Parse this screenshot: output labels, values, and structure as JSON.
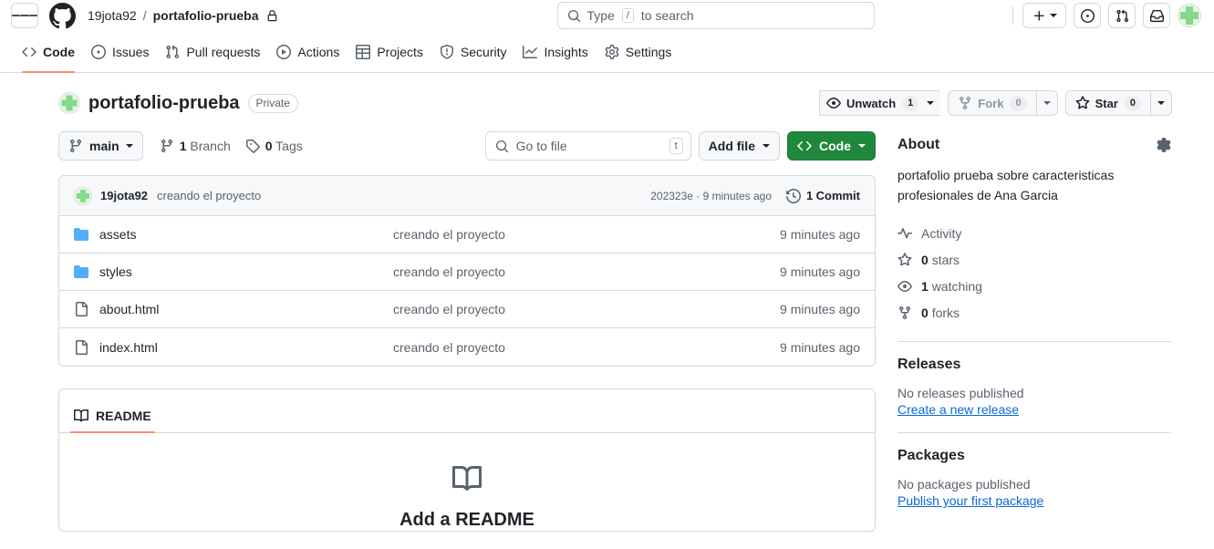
{
  "header": {
    "menu_label": "menu",
    "owner": "19jota92",
    "separator": "/",
    "repo": "portafolio-prueba",
    "search_placeholder": "Type",
    "search_key": "/",
    "search_placeholder_tail": "to search",
    "create_new_label": "create-new",
    "issues_label": "issues",
    "pull_requests_label": "pull-requests",
    "inbox_label": "inbox",
    "avatar_label": "19jota92"
  },
  "nav": {
    "items": [
      {
        "label": "Code",
        "icon": "code-icon",
        "active": true
      },
      {
        "label": "Issues",
        "icon": "issue-opened-icon",
        "active": false
      },
      {
        "label": "Pull requests",
        "icon": "git-pull-request-icon",
        "active": false
      },
      {
        "label": "Actions",
        "icon": "play-icon",
        "active": false
      },
      {
        "label": "Projects",
        "icon": "table-icon",
        "active": false
      },
      {
        "label": "Security",
        "icon": "shield-icon",
        "active": false
      },
      {
        "label": "Insights",
        "icon": "graph-icon",
        "active": false
      },
      {
        "label": "Settings",
        "icon": "gear-icon",
        "active": false
      }
    ]
  },
  "repo": {
    "name": "portafolio-prueba",
    "visibility": "Private",
    "watch_label": "Unwatch",
    "watch_count": "1",
    "fork_label": "Fork",
    "fork_count": "0",
    "star_label": "Star",
    "star_count": "0"
  },
  "toolbar": {
    "branch": "main",
    "branch_count": "1",
    "branch_word": "Branch",
    "tag_count": "0",
    "tag_word": "Tags",
    "gotofile_placeholder": "Go to file",
    "gotofile_key": "t",
    "add_file_label": "Add file",
    "code_label": "Code"
  },
  "commit": {
    "author": "19jota92",
    "message": "creando el proyecto",
    "hash": "202323e",
    "separator": "·",
    "time": "9 minutes ago",
    "count": "1",
    "count_word": "Commit"
  },
  "files": [
    {
      "name": "assets",
      "type": "folder",
      "message": "creando el proyecto",
      "time": "9 minutes ago"
    },
    {
      "name": "styles",
      "type": "folder",
      "message": "creando el proyecto",
      "time": "9 minutes ago"
    },
    {
      "name": "about.html",
      "type": "file",
      "message": "creando el proyecto",
      "time": "9 minutes ago"
    },
    {
      "name": "index.html",
      "type": "file",
      "message": "creando el proyecto",
      "time": "9 minutes ago"
    }
  ],
  "readme": {
    "tab_label": "README",
    "empty_title": "Add a README"
  },
  "about": {
    "title": "About",
    "description": "portafolio prueba sobre caracteristicas profesionales de Ana Garcia",
    "stats": [
      {
        "icon": "pulse-icon",
        "label": "Activity",
        "value": ""
      },
      {
        "icon": "star-icon",
        "value": "0",
        "label": "stars"
      },
      {
        "icon": "eye-icon",
        "value": "1",
        "label": "watching"
      },
      {
        "icon": "fork-icon",
        "value": "0",
        "label": "forks"
      }
    ]
  },
  "releases": {
    "title": "Releases",
    "empty": "No releases published",
    "link": "Create a new release"
  },
  "packages": {
    "title": "Packages",
    "empty": "No packages published",
    "link": "Publish your first package"
  },
  "colors": {
    "accent_green": "#1f883d",
    "tab_underline": "#fd8c73",
    "link_blue": "#0969da",
    "border": "#d1d9e0",
    "muted_text": "#59636e",
    "folder_blue": "#54aeff"
  }
}
